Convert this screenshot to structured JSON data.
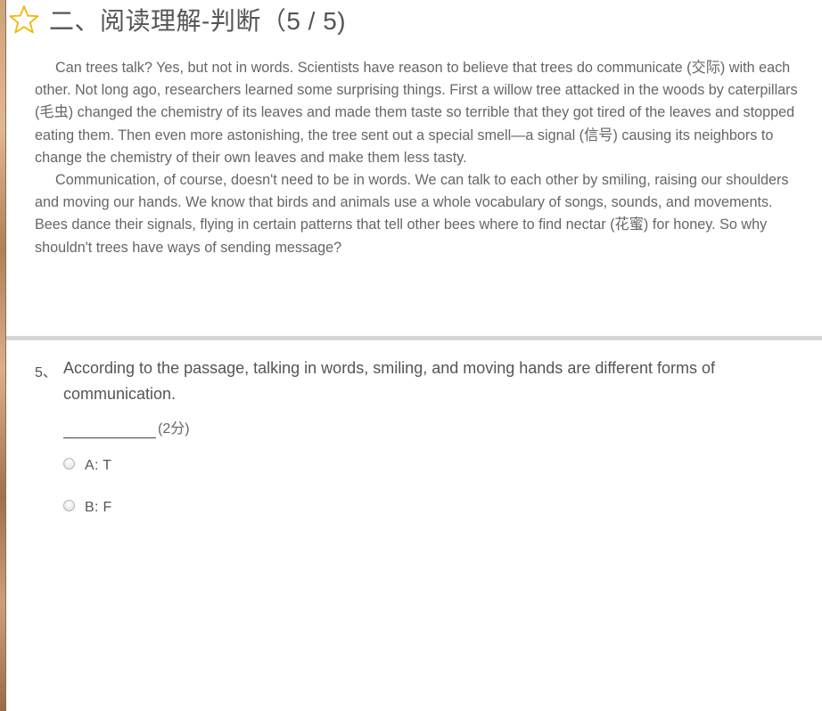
{
  "section": {
    "title": "二、阅读理解-判断（5 / 5)",
    "icon": "star-outline-icon",
    "icon_color": "#f2b705"
  },
  "passage": {
    "paragraphs": [
      "Can trees talk? Yes, but not in words. Scientists have reason to believe that trees do communicate (交际) with each other. Not long ago, researchers learned some surprising things. First a willow tree attacked in the woods by caterpillars (毛虫) changed the chemistry of its leaves and made them taste so terrible that they got tired of the leaves and stopped eating them. Then even more astonishing, the tree sent out a special smell—a signal (信号) causing its neighbors to change the chemistry of their own leaves and make them less tasty.",
      "Communication, of course, doesn't need to be in words. We can talk to each other by smiling, raising our shoulders and moving our hands. We know that birds and animals use a whole vocabulary of songs, sounds, and movements. Bees dance their signals, flying in certain patterns that tell other bees where to find nectar (花蜜) for honey. So why shouldn't trees have ways of sending message?"
    ]
  },
  "question": {
    "number": "5、",
    "text": "According to the passage, talking in words, smiling, and moving hands are different forms of communication.",
    "score": "(2分)",
    "options": [
      {
        "label": "A:  T",
        "selected": false
      },
      {
        "label": "B:  F",
        "selected": false
      }
    ]
  }
}
